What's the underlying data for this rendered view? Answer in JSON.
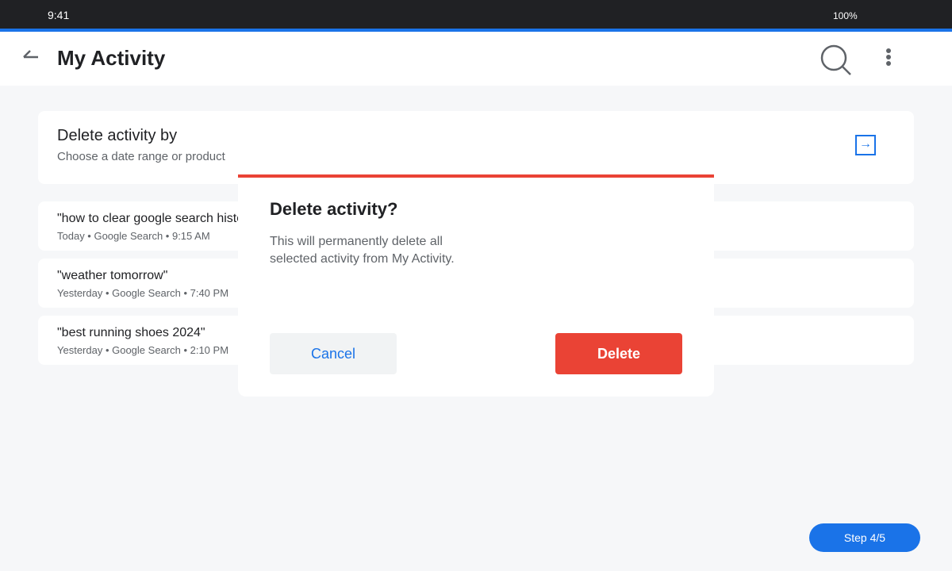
{
  "status_bar": {
    "time": "9:41",
    "battery": "100%"
  },
  "header": {
    "title": "My Activity",
    "back_icon": "back-arrow-icon",
    "search_icon": "search-icon",
    "more_icon": "more-vert-icon"
  },
  "delete_by": {
    "title": "Delete activity by",
    "subtitle": "Choose a date range or product",
    "arrow_glyph": "→",
    "arrow_icon": "arrow-right-icon"
  },
  "activity": [
    {
      "title": "\"how to clear google search history\"",
      "meta": "Today • Google Search • 9:15 AM"
    },
    {
      "title": "\"weather tomorrow\"",
      "meta": "Yesterday • Google Search • 7:40 PM"
    },
    {
      "title": "\"best running shoes 2024\"",
      "meta": "Yesterday • Google Search • 2:10 PM"
    }
  ],
  "dialog": {
    "title": "Delete activity?",
    "body": "This will permanently delete all selected activity from My Activity.",
    "cancel_label": "Cancel",
    "delete_label": "Delete"
  },
  "step": {
    "label": "Step 4/5"
  },
  "colors": {
    "accent": "#1a73e8",
    "danger": "#ea4335",
    "status_bar": "#202124",
    "background": "#f6f7f9"
  }
}
